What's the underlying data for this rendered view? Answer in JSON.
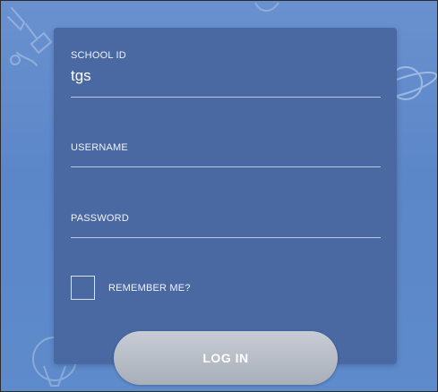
{
  "form": {
    "school_id": {
      "label": "SCHOOL ID",
      "value": "tgs"
    },
    "username": {
      "label": "USERNAME",
      "value": ""
    },
    "password": {
      "label": "PASSWORD",
      "value": ""
    },
    "remember": {
      "label": "REMEMBER ME?",
      "checked": false
    },
    "login_label": "LOG IN"
  },
  "colors": {
    "background": "#6a91cf",
    "card": "#4a69a3",
    "button": "#b5bbc5"
  }
}
